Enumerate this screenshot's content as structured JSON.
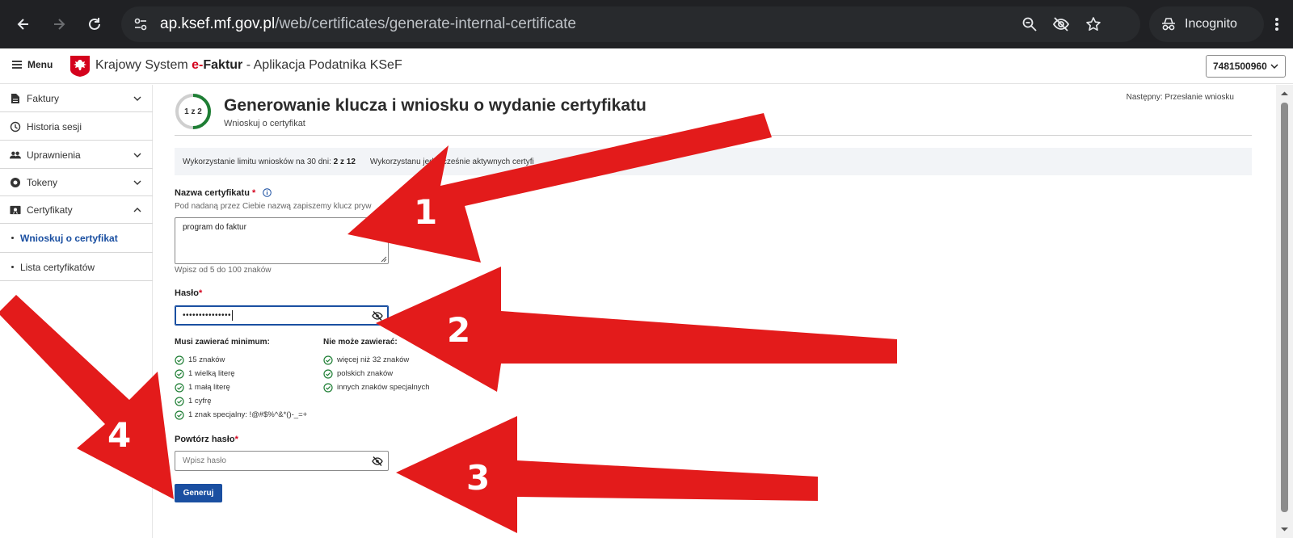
{
  "browser": {
    "url_host": "ap.ksef.mf.gov.pl",
    "url_path": "/web/certificates/generate-internal-certificate",
    "profile_label": "Incognito"
  },
  "header": {
    "menu_label": "Menu",
    "title_prefix": "Krajowy System ",
    "title_e": "e-",
    "title_faktur": "Faktur",
    "title_suffix": " - Aplikacja Podatnika KSeF",
    "nip": "7481500960"
  },
  "sidebar": {
    "items": [
      {
        "label": "Faktury",
        "icon": "document-icon"
      },
      {
        "label": "Historia sesji",
        "icon": "clock-icon"
      },
      {
        "label": "Uprawnienia",
        "icon": "people-icon"
      },
      {
        "label": "Tokeny",
        "icon": "token-icon"
      },
      {
        "label": "Certyfikaty",
        "icon": "certificate-icon"
      }
    ],
    "subitems": [
      {
        "label": "Wnioskuj o certyfikat",
        "active": true
      },
      {
        "label": "Lista certyfikatów",
        "active": false
      }
    ]
  },
  "main": {
    "step": "1 z 2",
    "step_progress": 0.5,
    "title": "Generowanie klucza i wniosku o wydanie certyfikatu",
    "subtitle": "Wnioskuj o certyfikat",
    "next_step": "Następny: Przesłanie wniosku",
    "limit1_label": "Wykorzystanie limitu wniosków na 30 dni: ",
    "limit1_value": "2 z 12",
    "limit2_label": "Wykorzystan",
    "limit2_tail": "u jednocześnie aktywnych certyfi",
    "cert_name_label": "Nazwa certyfikatu",
    "cert_name_hint": "Pod nadaną przez Ciebie nazwą zapiszemy klucz pryw",
    "cert_name_value": "program do faktur",
    "cert_name_length_hint": "Wpisz od 5 do 100 znaków",
    "password_label": "Hasło",
    "password_value": "•••••••••••••••",
    "must_contain_title": "Musi zawierać minimum:",
    "must_contain": [
      "15 znaków",
      "1 wielką literę",
      "1 małą literę",
      "1 cyfrę",
      "1 znak specjalny: !@#$%^&*()-_=+"
    ],
    "must_not_title": "Nie może zawierać:",
    "must_not": [
      "więcej niż 32 znaków",
      "polskich znaków",
      "innych znaków specjalnych"
    ],
    "repeat_label": "Powtórz hasło",
    "repeat_placeholder": "Wpisz hasło",
    "generate_label": "Generuj"
  },
  "annotations": [
    "1",
    "2",
    "3",
    "4"
  ],
  "colors": {
    "accent": "#1a4fa1",
    "required": "#d4021d",
    "check": "#1e7e34",
    "arrow": "#e31b1b"
  }
}
